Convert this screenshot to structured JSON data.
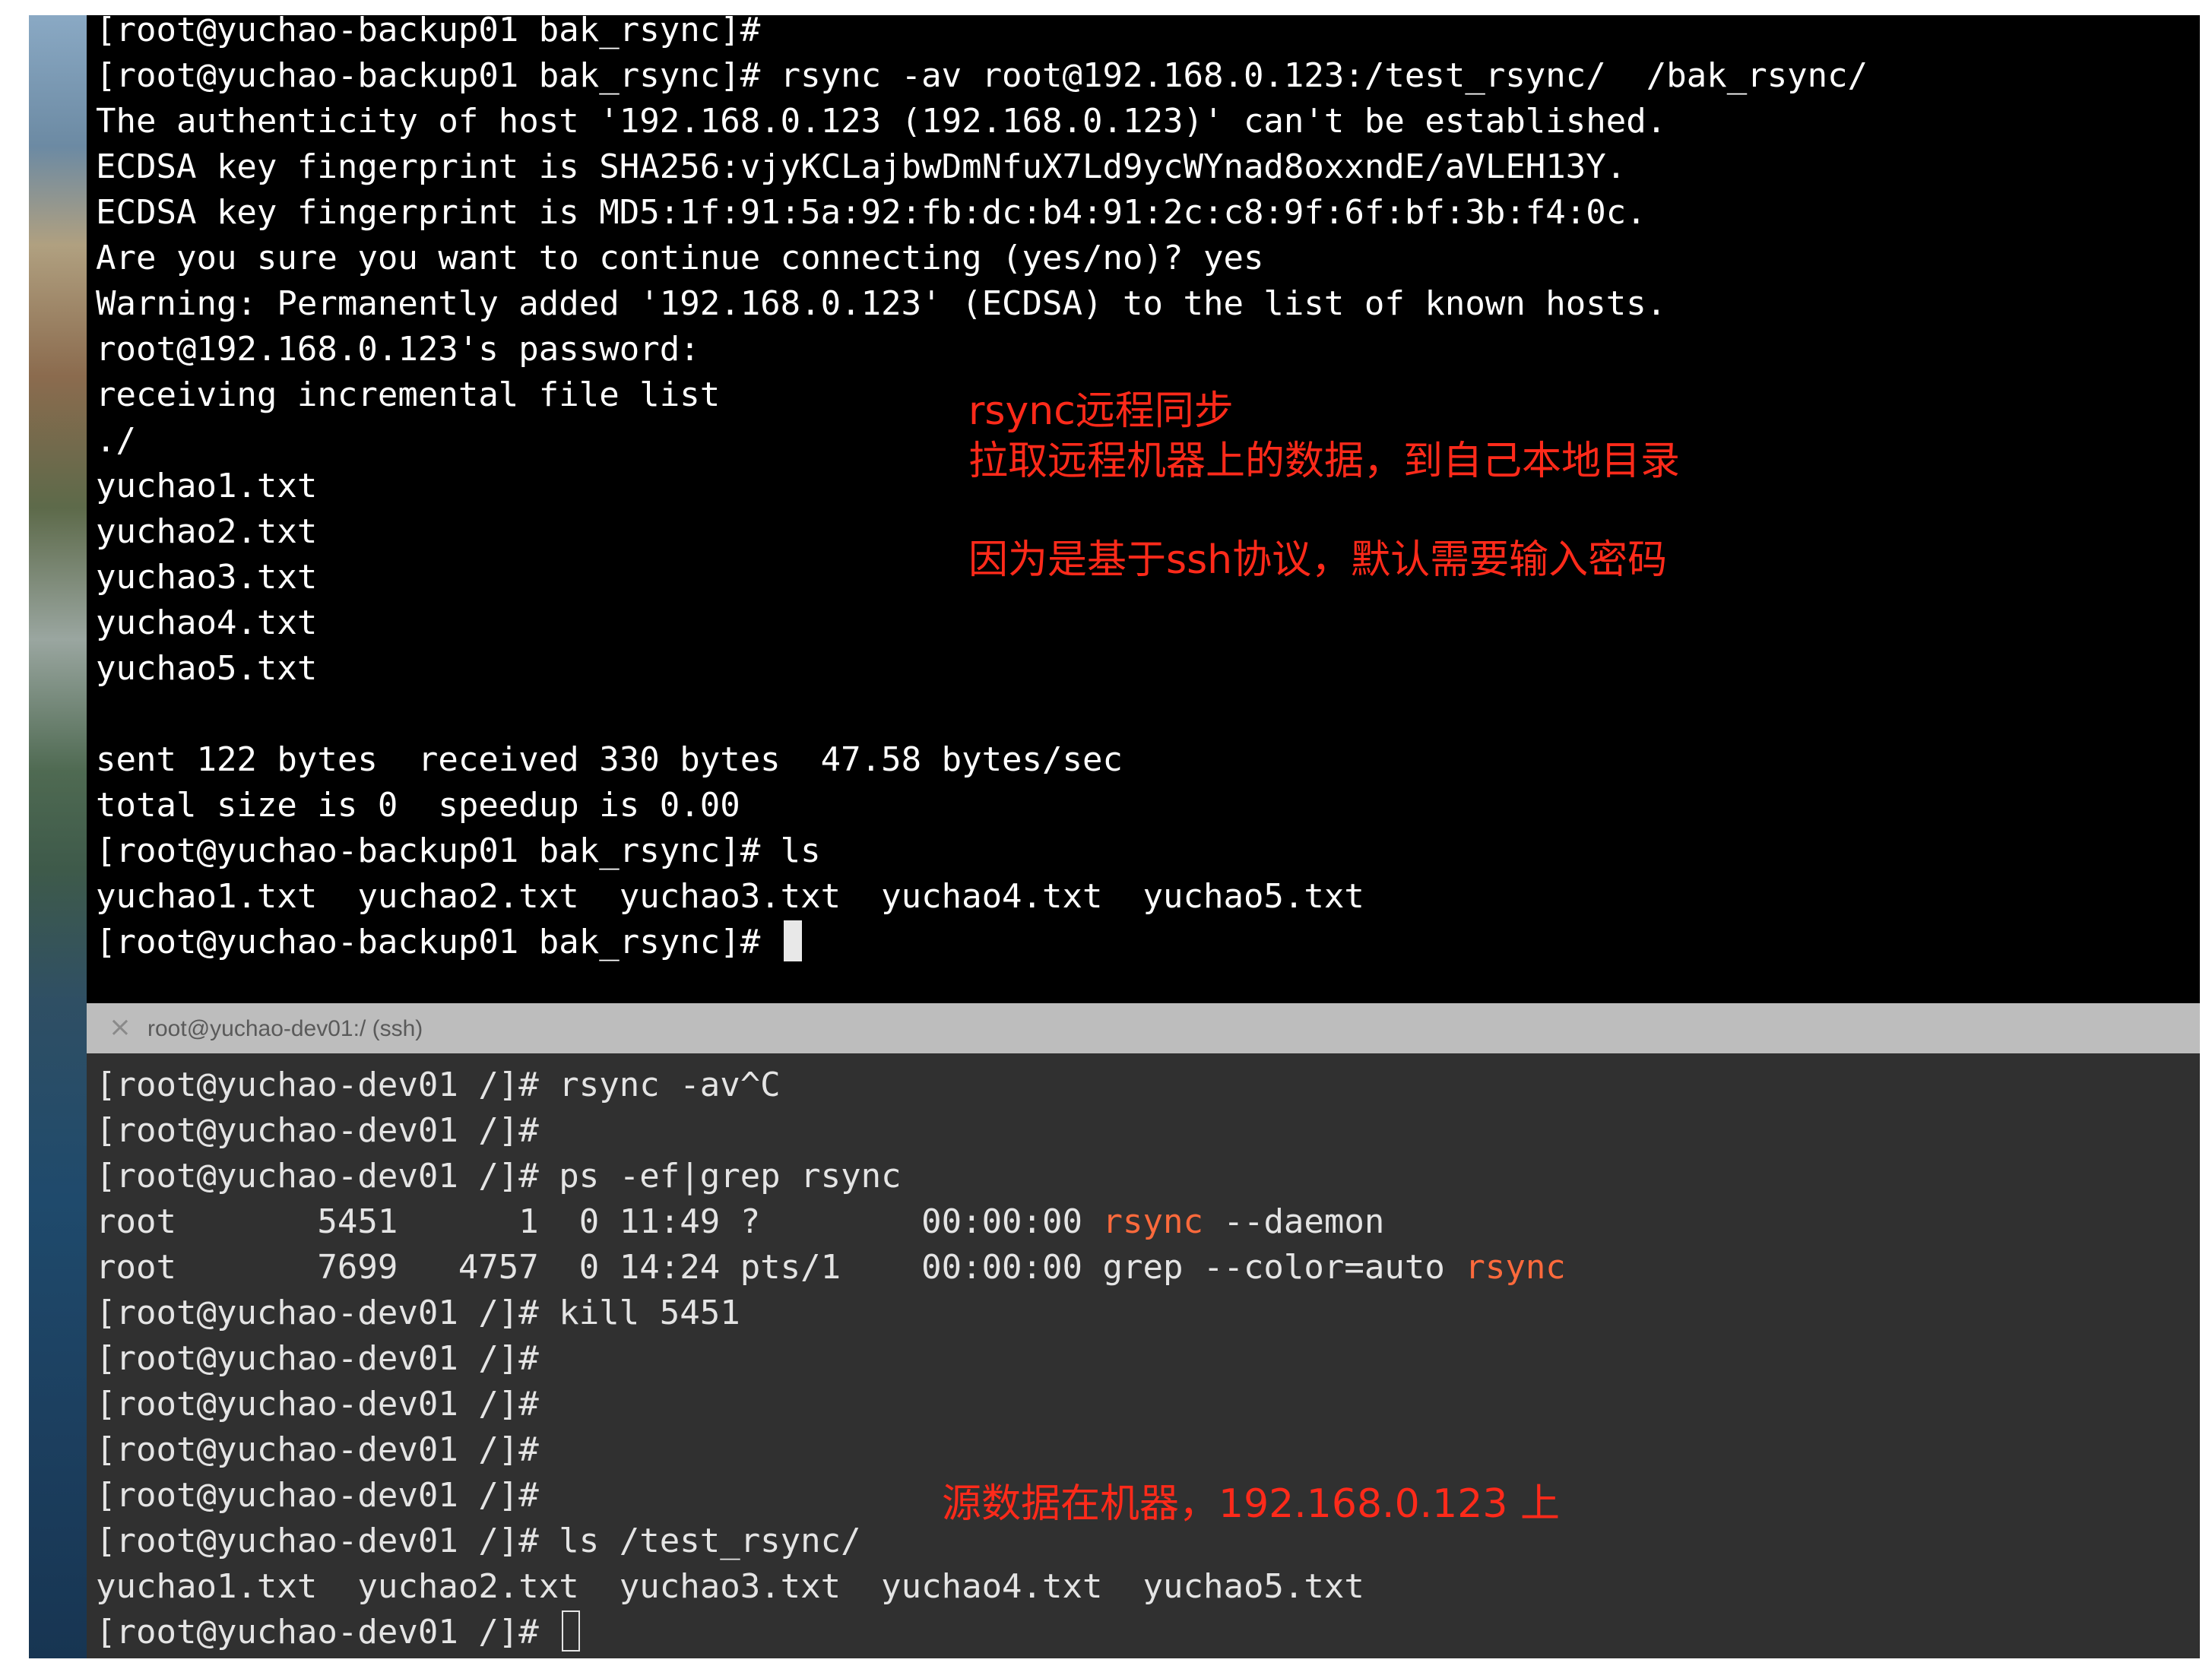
{
  "colors": {
    "terminal_top_bg": "#000000",
    "terminal_bottom_bg": "#303030",
    "annotation": "#ff2a1a",
    "match_highlight": "#ff6a3c"
  },
  "top_terminal": {
    "lines": [
      "[root@yuchao-backup01 bak_rsync]#",
      "[root@yuchao-backup01 bak_rsync]# rsync -av root@192.168.0.123:/test_rsync/  /bak_rsync/",
      "The authenticity of host '192.168.0.123 (192.168.0.123)' can't be established.",
      "ECDSA key fingerprint is SHA256:vjyKCLajbwDmNfuX7Ld9ycWYnad8oxxndE/aVLEH13Y.",
      "ECDSA key fingerprint is MD5:1f:91:5a:92:fb:dc:b4:91:2c:c8:9f:6f:bf:3b:f4:0c.",
      "Are you sure you want to continue connecting (yes/no)? yes",
      "Warning: Permanently added '192.168.0.123' (ECDSA) to the list of known hosts.",
      "root@192.168.0.123's password:",
      "receiving incremental file list",
      "./",
      "yuchao1.txt",
      "yuchao2.txt",
      "yuchao3.txt",
      "yuchao4.txt",
      "yuchao5.txt",
      "",
      "sent 122 bytes  received 330 bytes  47.58 bytes/sec",
      "total size is 0  speedup is 0.00",
      "[root@yuchao-backup01 bak_rsync]# ls",
      "yuchao1.txt  yuchao2.txt  yuchao3.txt  yuchao4.txt  yuchao5.txt",
      "[root@yuchao-backup01 bak_rsync]# "
    ],
    "annotations": [
      "rsync远程同步",
      "拉取远程机器上的数据，到自己本地目录",
      "因为是基于ssh协议，默认需要输入密码"
    ]
  },
  "tab": {
    "close_icon": "×",
    "title": "root@yuchao-dev01:/ (ssh)"
  },
  "bottom_terminal": {
    "lines": [
      "[root@yuchao-dev01 /]# rsync -av^C",
      "[root@yuchao-dev01 /]#",
      "[root@yuchao-dev01 /]# ps -ef|grep rsync",
      "",
      "",
      "[root@yuchao-dev01 /]# kill 5451",
      "[root@yuchao-dev01 /]#",
      "[root@yuchao-dev01 /]#",
      "[root@yuchao-dev01 /]#",
      "[root@yuchao-dev01 /]#",
      "[root@yuchao-dev01 /]# ls /test_rsync/",
      "yuchao1.txt  yuchao2.txt  yuchao3.txt  yuchao4.txt  yuchao5.txt",
      "[root@yuchao-dev01 /]# "
    ],
    "ps_row_1": {
      "prefix": "root       5451      1  0 11:49 ?        00:00:00 ",
      "match": "rsync",
      "suffix": " --daemon"
    },
    "ps_row_2": {
      "prefix": "root       7699   4757  0 14:24 pts/1    00:00:00 grep --color=auto ",
      "match": "rsync",
      "suffix": ""
    },
    "annotation": "源数据在机器，192.168.0.123 上"
  }
}
